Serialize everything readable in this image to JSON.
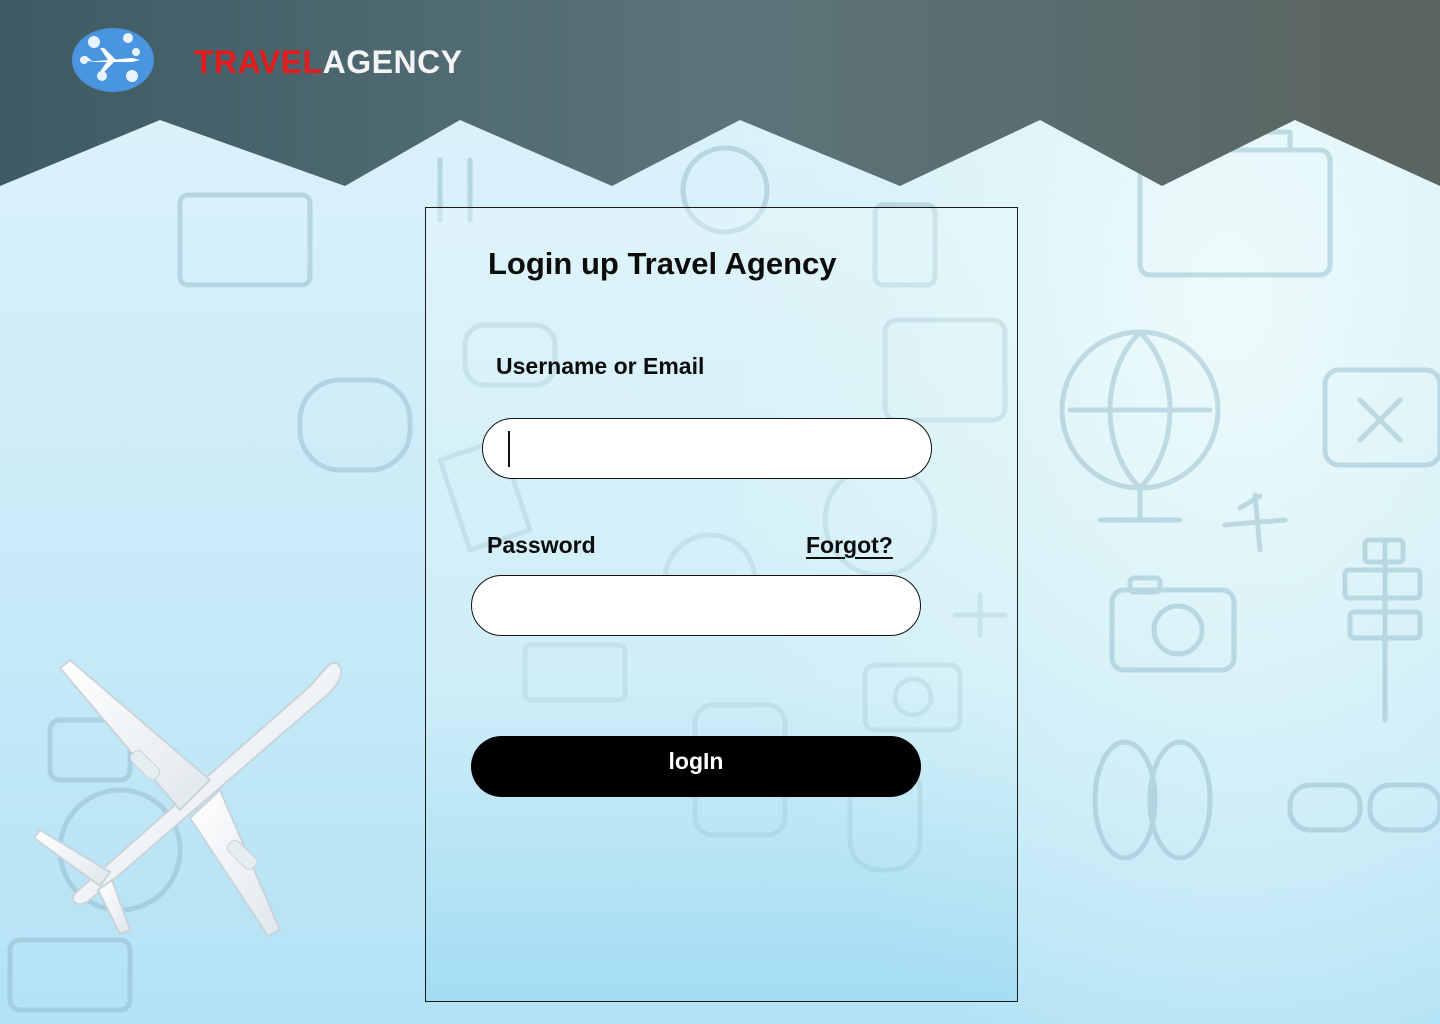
{
  "header": {
    "brand_part1": "TRAVEL",
    "brand_part2": "AGENCY",
    "logo_icon": "airplane-globe-icon"
  },
  "form": {
    "title": "Login up Travel Agency",
    "username_label": "Username or Email",
    "username_value": "",
    "password_label": "Password",
    "password_value": "",
    "forgot_link": "Forgot?",
    "login_button": "logIn"
  },
  "colors": {
    "brand_red": "#e51b1b",
    "brand_white": "#f4f4f4",
    "header_band": "#4a6670",
    "button_bg": "#000000",
    "background": "#c9ebf8"
  },
  "decorations": {
    "background_icons": [
      "camera-icon",
      "globe-icon",
      "suitcase-icon",
      "airplane-icon",
      "signpost-icon",
      "flip-flops-icon",
      "sunglasses-icon",
      "map-icon",
      "passport-icon",
      "ticket-icon"
    ],
    "hero_image": "airplane-top-view"
  }
}
